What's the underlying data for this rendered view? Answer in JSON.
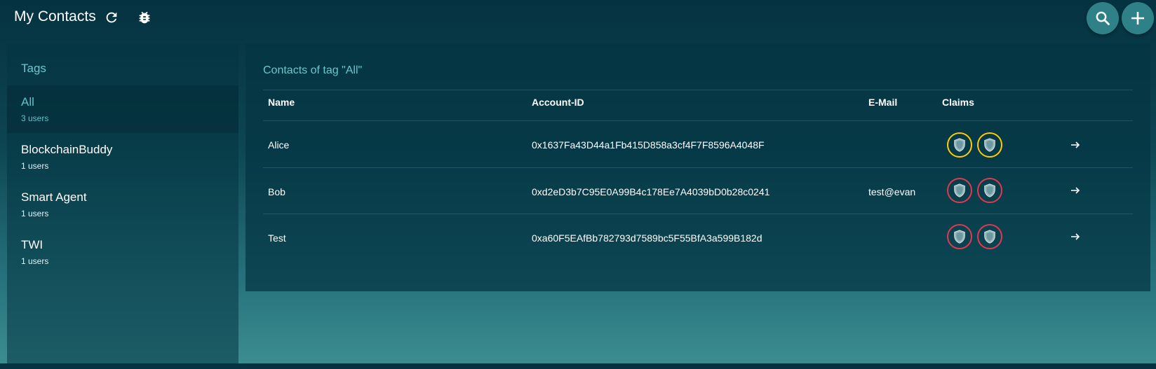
{
  "header": {
    "title": "My Contacts",
    "icons": [
      "refresh-icon",
      "bug-icon",
      "search-icon",
      "plus-icon"
    ]
  },
  "sidebar": {
    "title": "Tags",
    "items": [
      {
        "name": "All",
        "count": "3 users",
        "active": true
      },
      {
        "name": "BlockchainBuddy",
        "count": "1 users",
        "active": false
      },
      {
        "name": "Smart Agent",
        "count": "1 users",
        "active": false
      },
      {
        "name": "TWI",
        "count": "1 users",
        "active": false
      }
    ]
  },
  "main": {
    "title": "Contacts of tag \"All\"",
    "columns": {
      "name": "Name",
      "account": "Account-ID",
      "email": "E-Mail",
      "claims": "Claims"
    },
    "rows": [
      {
        "name": "Alice",
        "account": "0x1637Fa43D44a1Fb415D858a3cf4F7F8596A4048F",
        "email": "",
        "claim_status": "pending"
      },
      {
        "name": "Bob",
        "account": "0xd2eD3b7C95E0A99B4c178Ee7A4039bD0b28c0241",
        "email": "test@evan",
        "claim_status": "rejected"
      },
      {
        "name": "Test",
        "account": "0xa60F5EAfBb782793d7589bc5F55BfA3a599B182d",
        "email": "",
        "claim_status": "rejected"
      }
    ]
  },
  "colors": {
    "accent": "#5fc4c9",
    "claim_pending": "#ffcc00",
    "claim_rejected": "#e03a4e",
    "button": "#2e8287"
  }
}
